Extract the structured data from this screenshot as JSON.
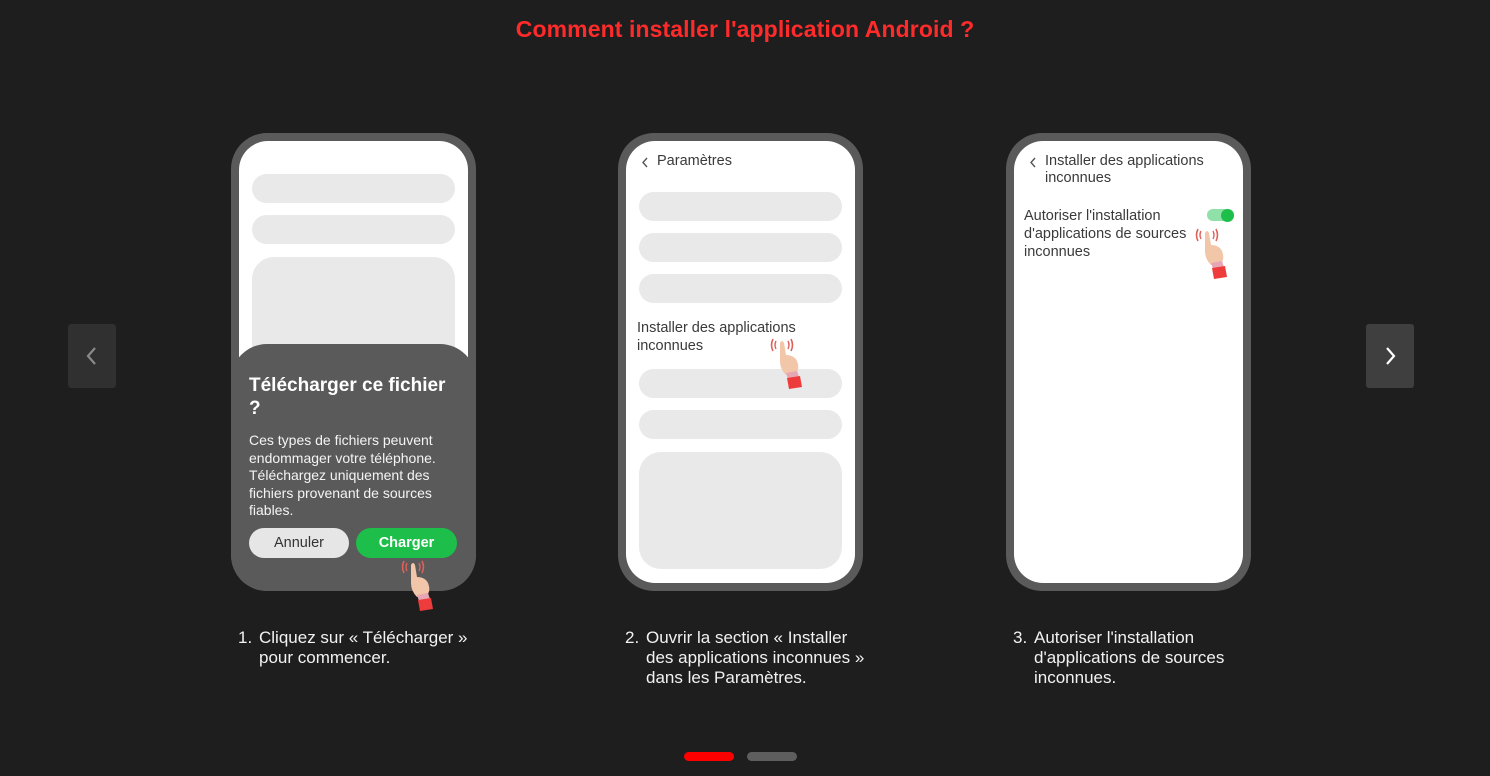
{
  "title": "Comment installer l'application Android ?",
  "colors": {
    "accent": "#ff2b2b",
    "background": "#1e1e1e",
    "phone_frame": "#5a5a5a",
    "placeholder": "#e9e9e9",
    "green": "#1dbf4a",
    "dot_active": "#ff0000",
    "dot_inactive": "#5e5e5e"
  },
  "nav": {
    "prev_icon": "chevron-left-icon",
    "next_icon": "chevron-right-icon"
  },
  "steps": [
    {
      "number": "1.",
      "caption": "Cliquez sur « Télécharger » pour commencer.",
      "dialog": {
        "title": "Télécharger ce fichier ?",
        "body": "Ces types de fichiers peuvent endommager votre téléphone. Téléchargez uniquement des fichiers provenant de sources fiables.",
        "cancel_label": "Annuler",
        "confirm_label": "Charger"
      }
    },
    {
      "number": "2.",
      "caption": "Ouvrir la section « Installer des applications inconnues » dans les Paramètres.",
      "screen_header": "Paramètres",
      "item_label": "Installer des applications inconnues"
    },
    {
      "number": "3.",
      "caption": "Autoriser l'installation d'applications de sources inconnues.",
      "screen_header": "Installer des applications inconnues",
      "setting_label": "Autoriser l'installation d'applications de sources inconnues",
      "toggle_on": true
    }
  ],
  "pagination": {
    "pages": 2,
    "active": 1
  }
}
